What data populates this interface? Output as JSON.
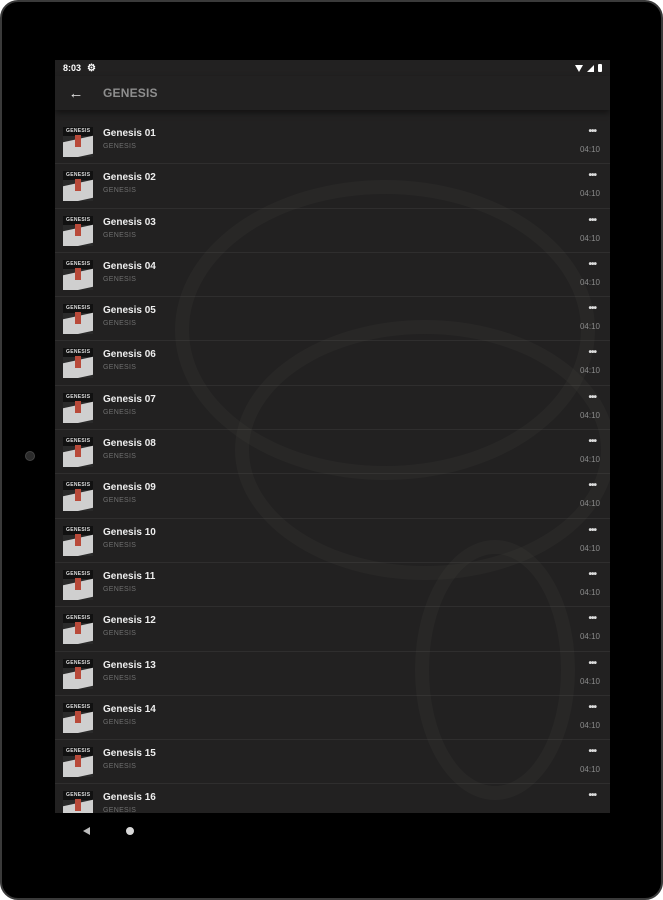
{
  "status_bar": {
    "time": "8:03",
    "settings_icon": "gear-icon",
    "wifi_icon": "wifi-icon",
    "signal_icon": "signal-icon",
    "battery_icon": "battery-icon"
  },
  "app_bar": {
    "back_icon": "arrow-back-icon",
    "title": "GENESIS"
  },
  "tracks": [
    {
      "title": "Genesis 01",
      "subtitle": "GENESIS",
      "duration": "04:10",
      "more": "•••"
    },
    {
      "title": "Genesis 02",
      "subtitle": "GENESIS",
      "duration": "04:10",
      "more": "•••"
    },
    {
      "title": "Genesis 03",
      "subtitle": "GENESIS",
      "duration": "04:10",
      "more": "•••"
    },
    {
      "title": "Genesis 04",
      "subtitle": "GENESIS",
      "duration": "04:10",
      "more": "•••"
    },
    {
      "title": "Genesis 05",
      "subtitle": "GENESIS",
      "duration": "04:10",
      "more": "•••"
    },
    {
      "title": "Genesis 06",
      "subtitle": "GENESIS",
      "duration": "04:10",
      "more": "•••"
    },
    {
      "title": "Genesis 07",
      "subtitle": "GENESIS",
      "duration": "04:10",
      "more": "•••"
    },
    {
      "title": "Genesis 08",
      "subtitle": "GENESIS",
      "duration": "04:10",
      "more": "•••"
    },
    {
      "title": "Genesis 09",
      "subtitle": "GENESIS",
      "duration": "04:10",
      "more": "•••"
    },
    {
      "title": "Genesis 10",
      "subtitle": "GENESIS",
      "duration": "04:10",
      "more": "•••"
    },
    {
      "title": "Genesis 11",
      "subtitle": "GENESIS",
      "duration": "04:10",
      "more": "•••"
    },
    {
      "title": "Genesis 12",
      "subtitle": "GENESIS",
      "duration": "04:10",
      "more": "•••"
    },
    {
      "title": "Genesis 13",
      "subtitle": "GENESIS",
      "duration": "04:10",
      "more": "•••"
    },
    {
      "title": "Genesis 14",
      "subtitle": "GENESIS",
      "duration": "04:10",
      "more": "•••"
    },
    {
      "title": "Genesis 15",
      "subtitle": "GENESIS",
      "duration": "04:10",
      "more": "•••"
    },
    {
      "title": "Genesis 16",
      "subtitle": "GENESIS",
      "duration": "",
      "more": "•••"
    }
  ],
  "thumbnail": {
    "label": "GENESIS",
    "icon": "album-art-icon"
  },
  "nav_bar": {
    "back_icon": "nav-back-icon",
    "home_icon": "nav-home-icon"
  },
  "colors": {
    "background": "#222121",
    "title_text": "#eeeeee",
    "subtitle_text": "#6f6f6f",
    "app_title": "#8e8e8e"
  }
}
